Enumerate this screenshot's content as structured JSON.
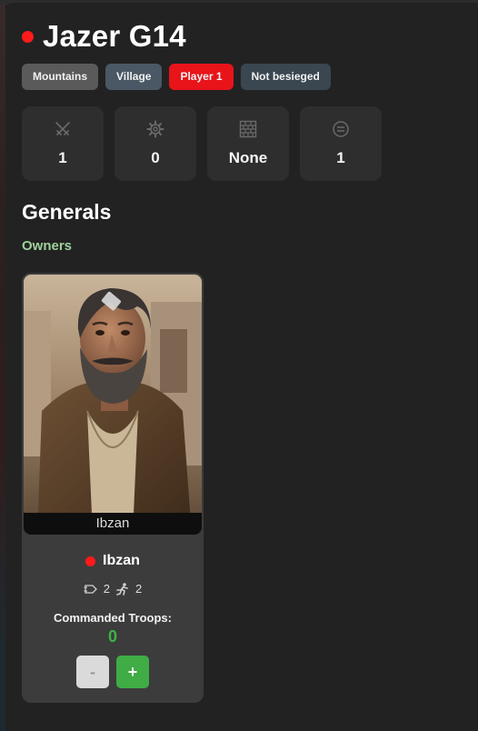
{
  "location": {
    "name": "Jazer G14",
    "owner_color": "#ff1a1a"
  },
  "tags": {
    "terrain": "Mountains",
    "type": "Village",
    "owner": "Player 1",
    "siege": "Not besieged"
  },
  "stats": [
    {
      "icon": "crossed-swords-icon",
      "value": "1"
    },
    {
      "icon": "gear-icon",
      "value": "0"
    },
    {
      "icon": "brick-wall-icon",
      "value": "None"
    },
    {
      "icon": "face-icon",
      "value": "1"
    }
  ],
  "generals_section": {
    "title": "Generals",
    "owners_label": "Owners"
  },
  "general": {
    "portrait_caption": "Ibzan",
    "name": "Ibzan",
    "owner_color": "#ff1a1a",
    "attr_1": "2",
    "attr_2": "2",
    "troops_label": "Commanded Troops:",
    "troops_value": "0",
    "minus_label": "-",
    "plus_label": "+"
  }
}
